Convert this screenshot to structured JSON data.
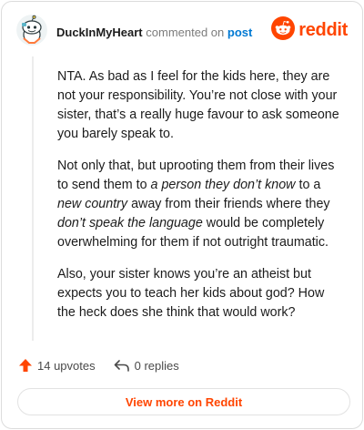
{
  "comment": {
    "username": "DuckInMyHeart",
    "verb": "commented on",
    "link_text": "post",
    "paragraphs": [
      [
        {
          "text": "NTA. As bad as I feel for the kids here, they are not your responsibility. You’re not close with your sister, that’s a really huge favour to ask someone you barely speak to.",
          "em": false
        }
      ],
      [
        {
          "text": "Not only that, but uprooting them from their lives to send them to ",
          "em": false
        },
        {
          "text": "a person they don’t know",
          "em": true
        },
        {
          "text": " to a ",
          "em": false
        },
        {
          "text": "new country",
          "em": true
        },
        {
          "text": " away from their friends where they ",
          "em": false
        },
        {
          "text": "don’t speak the language",
          "em": true
        },
        {
          "text": " would be completely overwhelming for them if not outright traumatic.",
          "em": false
        }
      ],
      [
        {
          "text": "Also, your sister knows you’re an atheist but expects you to teach her kids about god? How the heck does she think that would work?",
          "em": false
        }
      ]
    ],
    "upvotes_label": "14 upvotes",
    "replies_label": "0 replies"
  },
  "brand": {
    "wordmark": "reddit",
    "color": "#ff4500"
  },
  "view_more_label": "View more on Reddit",
  "colors": {
    "accent": "#ff4500",
    "link": "#0079d3",
    "muted": "#7c7c7c"
  },
  "icons": {
    "avatar": "snoo-avatar-icon",
    "logo": "reddit-logo-icon",
    "upvote": "upvote-arrow-icon",
    "reply": "reply-arrow-icon"
  }
}
